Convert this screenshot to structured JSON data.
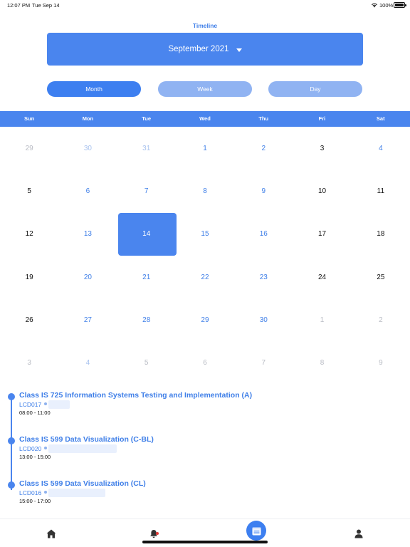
{
  "status_bar": {
    "time": "12:07 PM",
    "date": "Tue Sep 14",
    "battery": "100%",
    "icons": [
      "wifi-icon",
      "battery-icon"
    ]
  },
  "header": {
    "title": "Timeline",
    "month_selector": "September 2021",
    "accent_color": "#4a85ee"
  },
  "view_tabs": [
    {
      "label": "Month",
      "active": true
    },
    {
      "label": "Week",
      "active": false
    },
    {
      "label": "Day",
      "active": false
    }
  ],
  "calendar": {
    "weekdays": [
      "Sun",
      "Mon",
      "Tue",
      "Wed",
      "Thu",
      "Fri",
      "Sat"
    ],
    "selected_day": "14",
    "weeks": [
      [
        "29",
        "30",
        "31",
        "1",
        "2",
        "3",
        "4"
      ],
      [
        "5",
        "6",
        "7",
        "8",
        "9",
        "10",
        "11"
      ],
      [
        "12",
        "13",
        "14",
        "15",
        "16",
        "17",
        "18"
      ],
      [
        "19",
        "20",
        "21",
        "22",
        "23",
        "24",
        "25"
      ],
      [
        "26",
        "27",
        "28",
        "29",
        "30",
        "1",
        "2"
      ],
      [
        "3",
        "4",
        "5",
        "6",
        "7",
        "8",
        "9"
      ]
    ]
  },
  "events": [
    {
      "title": "Class IS 725 Information Systems Testing and Implementation (A)",
      "room": "LCD017",
      "time": "08:00 - 11:00"
    },
    {
      "title": "Class IS 599 Data Visualization (C-BL)",
      "room": "LCD020",
      "time": "13:00 - 15:00"
    },
    {
      "title": "Class IS 599 Data Visualization (CL)",
      "room": "LCD016",
      "time": "15:00 - 17:00"
    }
  ],
  "tab_bar": {
    "items": [
      "home-icon",
      "bell-icon",
      "calendar-icon",
      "profile-icon"
    ],
    "active": "calendar-icon"
  }
}
